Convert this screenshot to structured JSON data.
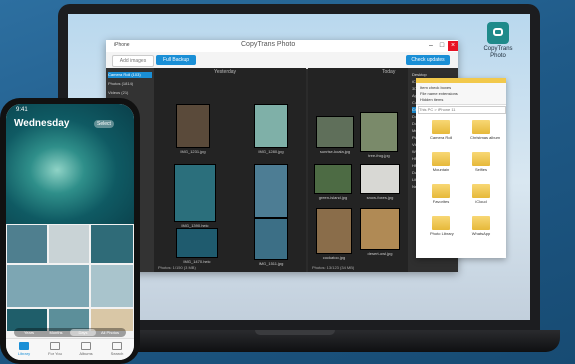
{
  "desktop": {
    "icon_label": "CopyTrans Photo"
  },
  "app": {
    "title": "CopyTrans Photo",
    "device": "iPhone",
    "toolbar": {
      "add_images": "Add images",
      "full_backup": "Full Backup",
      "check_updates": "Check updates"
    },
    "left_column": "Yesterday",
    "right_column": "Today",
    "albums": [
      {
        "label": "Camera Roll (103)",
        "selected": true
      },
      {
        "label": "Photos (1814)",
        "selected": false
      },
      {
        "label": "Videos (21)",
        "selected": false
      },
      {
        "label": "Selfies (5)",
        "selected": false
      },
      {
        "label": "Favorites",
        "selected": false
      },
      {
        "label": "Panoramas",
        "selected": false
      },
      {
        "label": "Screenshots",
        "selected": false
      },
      {
        "label": "Bursts",
        "selected": false
      },
      {
        "label": "Live Photos",
        "selected": false
      },
      {
        "label": "Portrait",
        "selected": false
      },
      {
        "label": "Slo-mo",
        "selected": false
      },
      {
        "label": "Time-lapse",
        "selected": false
      },
      {
        "label": "Recently Deleted",
        "selected": false
      }
    ],
    "thumbs_left": [
      {
        "cap": "IMG_1231.jpg",
        "color": "#5a4a3a"
      },
      {
        "cap": "IMG_1280.jpg",
        "color": "#7fb0a8"
      },
      {
        "cap": "IMG_1390.heic",
        "color": "#2b6f7c"
      },
      {
        "cap": "IMG_1442.jpg",
        "color": "#4d7d94"
      },
      {
        "cap": "IMG_1470.heic",
        "color": "#1f5b6e"
      },
      {
        "cap": "IMG_1511.jpg",
        "color": "#3c6f86"
      }
    ],
    "thumbs_right": [
      {
        "cap": "sunrise-koala.jpg",
        "color": "#5f6f5a"
      },
      {
        "cap": "tree-frog.jpg",
        "color": "#7a8a6a"
      },
      {
        "cap": "green-island.jpg",
        "color": "#4d6b44"
      },
      {
        "cap": "snow-foxes.jpg",
        "color": "#d8d8d4"
      },
      {
        "cap": "cockatoo.jpg",
        "color": "#8a6d4a"
      },
      {
        "cap": "desert-owl.jpg",
        "color": "#b08a55"
      }
    ],
    "tree": [
      {
        "label": "Desktop",
        "selected": false
      },
      {
        "label": "iCloud",
        "selected": false
      },
      {
        "label": "3D Objects",
        "selected": false
      },
      {
        "label": "Apple Photos",
        "selected": false
      },
      {
        "label": "Camera Roll",
        "selected": false
      },
      {
        "label": "Christmas",
        "selected": true
      },
      {
        "label": "Documents",
        "selected": false
      },
      {
        "label": "Downloads",
        "selected": false
      },
      {
        "label": "Music",
        "selected": false
      },
      {
        "label": "Pictures",
        "selected": false
      },
      {
        "label": "Videos",
        "selected": false
      },
      {
        "label": "Windows (C:)",
        "selected": false
      },
      {
        "label": "HP_RECOVERY",
        "selected": false
      },
      {
        "label": "HP_TOOLS (E:)",
        "selected": false
      },
      {
        "label": "Data (F:)",
        "selected": false
      },
      {
        "label": "Libraries",
        "selected": false
      },
      {
        "label": "Network",
        "selected": false
      }
    ],
    "status_left": "Photos: 1/150 (3 MB)",
    "status_right": "Photos: 13/123 (34 MB)"
  },
  "explorer": {
    "ribbon_options": [
      "Item check boxes",
      "File name extensions",
      "Hidden items"
    ],
    "path": "This PC > iPhone 11",
    "folders": [
      {
        "label": "Camera Roll"
      },
      {
        "label": "Christmas album"
      },
      {
        "label": "Mountain"
      },
      {
        "label": "Selfies"
      },
      {
        "label": "Favorites"
      },
      {
        "label": "iCloud"
      },
      {
        "label": "Photo Library"
      },
      {
        "label": "WhatsApp"
      }
    ]
  },
  "phone": {
    "time": "9:41",
    "title": "Wednesday",
    "select_label": "Select",
    "segments": [
      {
        "label": "Years",
        "selected": false
      },
      {
        "label": "Months",
        "selected": false
      },
      {
        "label": "Days",
        "selected": true
      },
      {
        "label": "All Photos",
        "selected": false
      }
    ],
    "tabs": [
      {
        "label": "Library",
        "active": true
      },
      {
        "label": "For You",
        "active": false
      },
      {
        "label": "Albums",
        "active": false
      },
      {
        "label": "Search",
        "active": false
      }
    ],
    "grid_colors": [
      "#4f7f8f",
      "#c9d3d6",
      "#2f6b78",
      "#7da6b3",
      "#a9c4cc",
      "#1f5e6a",
      "#5c8f9a",
      "#d9c7a6"
    ]
  }
}
